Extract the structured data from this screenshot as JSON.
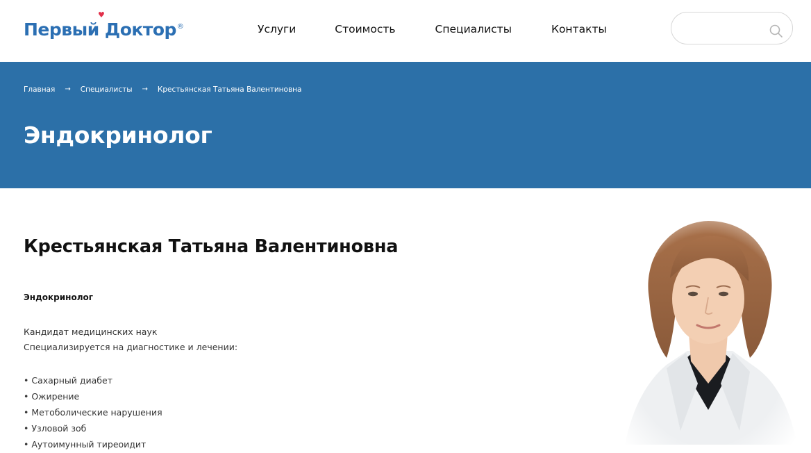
{
  "logo": {
    "text": "Первый Доктор",
    "reg": "®",
    "brand_color": "#2b6fb3",
    "accent_color": "#e2304a"
  },
  "nav": {
    "items": [
      {
        "label": "Услуги"
      },
      {
        "label": "Стоимость"
      },
      {
        "label": "Специалисты"
      },
      {
        "label": "Контакты"
      }
    ]
  },
  "search": {
    "value": "",
    "placeholder": "",
    "icon": "search-icon"
  },
  "banner": {
    "background": "#2c70a8",
    "breadcrumb": [
      {
        "label": "Главная"
      },
      {
        "label": "Специалисты"
      },
      {
        "label": "Крестьянская Татьяна Валентиновна"
      }
    ],
    "breadcrumb_separator": "→",
    "title": "Эндокринолог"
  },
  "doctor": {
    "name": "Крестьянская Татьяна Валентиновна",
    "specialty": "Эндокринолог",
    "degree": "Кандидат медицинских наук",
    "specialization_intro": "Специализируется на диагностике и лечении:",
    "conditions": [
      "• Сахарный диабет",
      "• Ожирение",
      "• Метоболические нарушения",
      "• Узловой зоб",
      "• Аутоимунный тиреоидит"
    ],
    "photo": "doctor-portrait"
  }
}
